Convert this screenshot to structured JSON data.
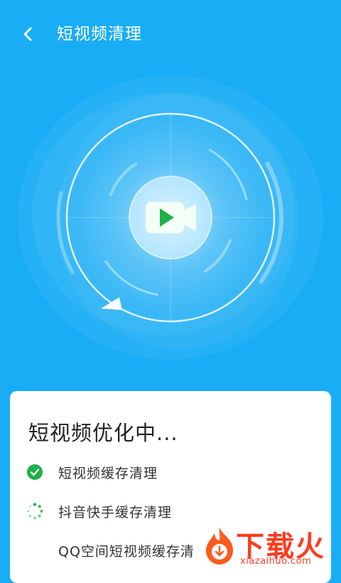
{
  "header": {
    "back_icon": "chevron-left-icon",
    "title": "短视频清理"
  },
  "scanner": {
    "center_icon": "video-camera-icon",
    "accent_color": "#19adf6",
    "play_color": "#1fb04a"
  },
  "card": {
    "title": "短视频优化中...",
    "tasks": [
      {
        "label": "短视频缓存清理",
        "status": "done",
        "icon": "check-circle-icon"
      },
      {
        "label": "抖音快手缓存清理",
        "status": "in-progress",
        "icon": "spinner-icon"
      },
      {
        "label": "QQ空间短视频缓存清",
        "status": "pending",
        "icon": ""
      }
    ]
  },
  "watermark": {
    "title": "下载火",
    "url": "xiazaihuo.com",
    "icon": "flame-logo-icon"
  }
}
